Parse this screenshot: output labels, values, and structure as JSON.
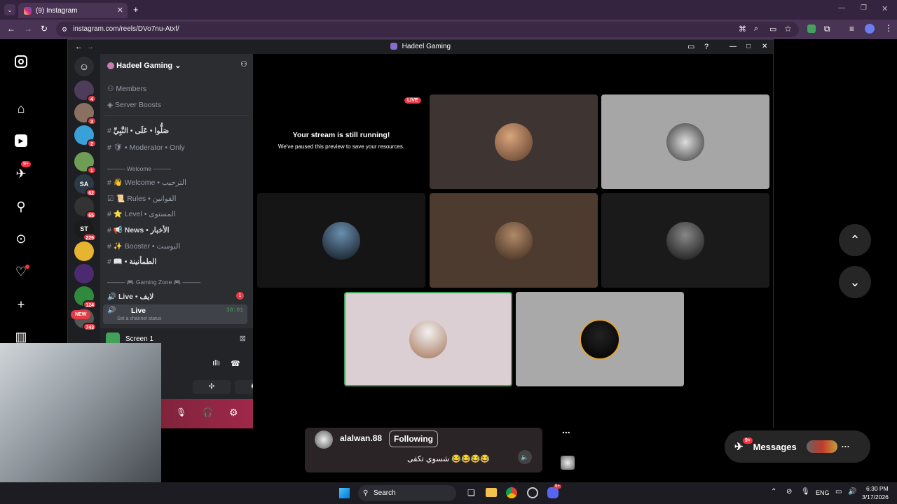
{
  "browser": {
    "tab_count_badge": "(9)",
    "tab_title": "(9) Instagram",
    "url": "instagram.com/reels/DVo7nu-Atxf/"
  },
  "discord": {
    "window_title": "Hadeel Gaming",
    "server_name": "Hadeel Gaming",
    "members_label": "Members",
    "boosts_label": "Server Boosts",
    "servers": [
      {
        "badge": "4"
      },
      {
        "badge": "3"
      },
      {
        "badge": "2"
      },
      {
        "badge": "1"
      },
      {
        "badge": "62"
      },
      {
        "badge": "65"
      },
      {
        "badge": "229"
      },
      {
        "badge": ""
      },
      {
        "badge": ""
      },
      {
        "badge": "124"
      },
      {
        "badge": "743"
      }
    ],
    "new_label": "NEW",
    "channels": {
      "c1": "صَلُّوا • عَلَى • النَّبِيِّ",
      "moderator": "• Moderator • Only",
      "welcome_cat": "Welcome",
      "welcome": "Welcome • الترحيب",
      "rules": "Rules • القوانين",
      "level": "Level • المستوى",
      "news": "News • الأخبار",
      "booster": "Booster • البوست",
      "c9": "• الطمأنينة",
      "gaming_cat": "Gaming Zone",
      "live_voice": "Live • لايف",
      "live_badge": "1",
      "live_active": "Live",
      "live_timer": "38:01",
      "status_hint": "Set a channel status"
    },
    "screen_share": "Screen 1",
    "paused_title": "Your stream is still running!",
    "paused_sub": "We've paused this preview to save your resources.",
    "live_tag": "LIVE"
  },
  "reel": {
    "username": "alalwan.88",
    "follow_label": "Following",
    "caption": "شسوي تكفى 😂😂😂😂",
    "more": "..."
  },
  "messages": {
    "label": "Messages",
    "badge": "9+"
  },
  "ig_badge": "9+",
  "taskbar": {
    "search": "Search",
    "lang": "ENG",
    "time": "6:30 PM",
    "date": "3/17/2026",
    "badge": "9+"
  },
  "colors": {
    "accent": "#5865f2",
    "live": "#e43b45",
    "browser_bg": "#35243f",
    "speaking": "#43a25a"
  }
}
